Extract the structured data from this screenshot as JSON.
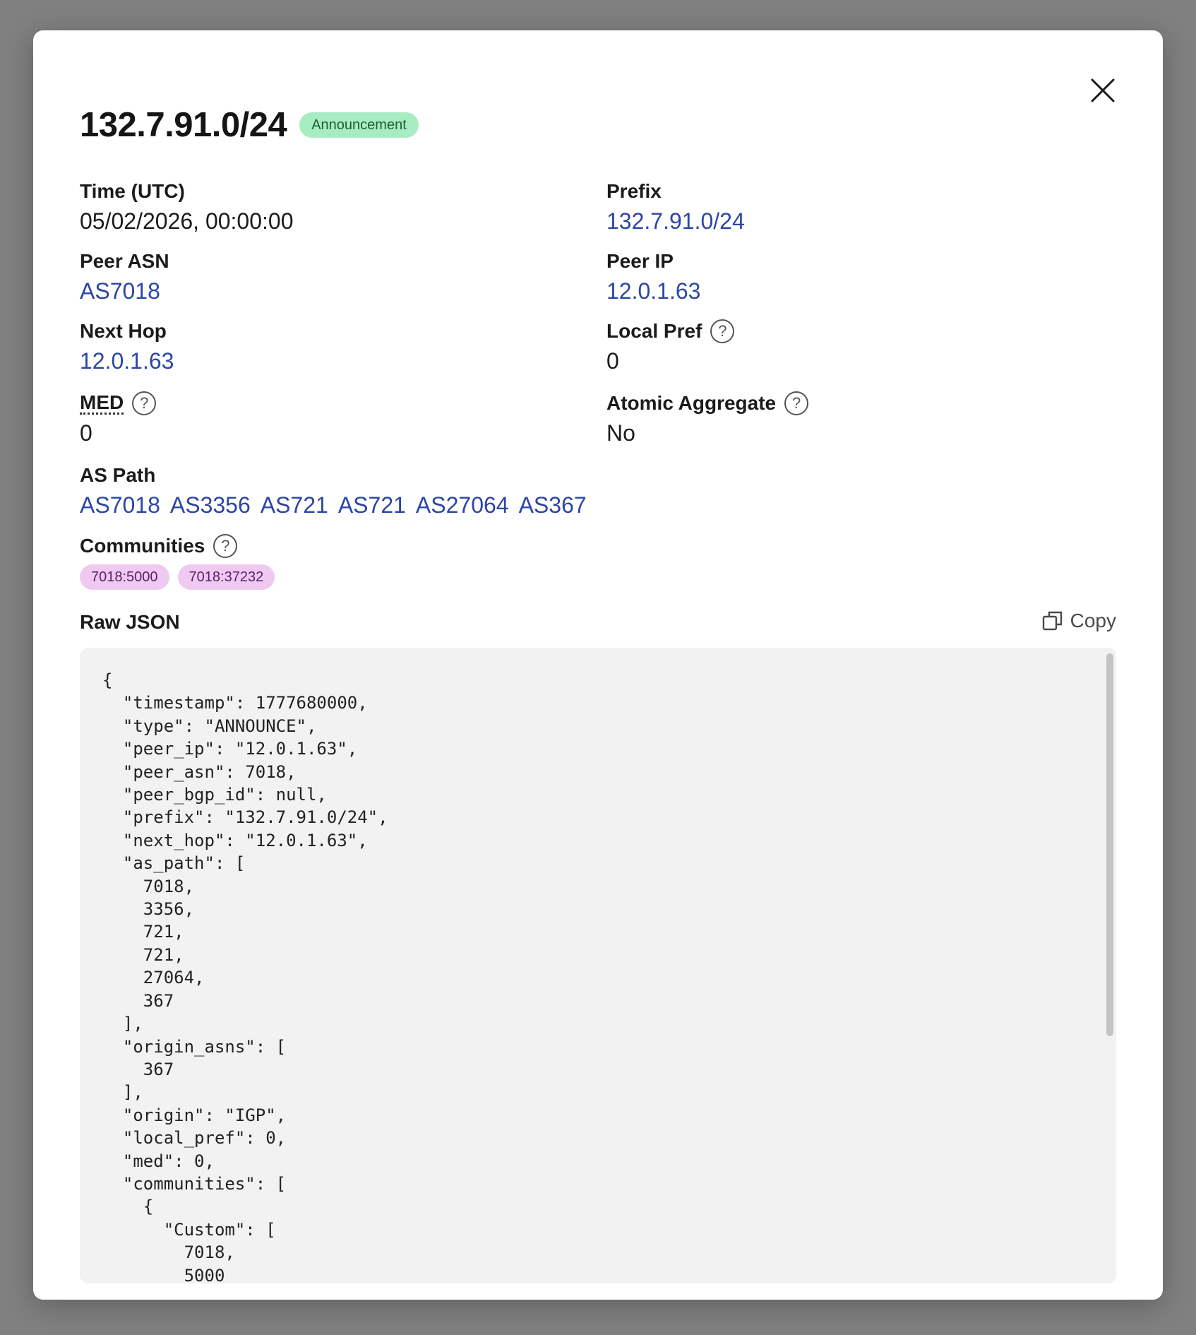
{
  "modal": {
    "title": "132.7.91.0/24",
    "badge": "Announcement",
    "close_icon": "close-icon"
  },
  "fields": {
    "time": {
      "label": "Time (UTC)",
      "value": "05/02/2026, 00:00:00"
    },
    "prefix": {
      "label": "Prefix",
      "value": "132.7.91.0/24"
    },
    "peer_asn": {
      "label": "Peer ASN",
      "value": "AS7018"
    },
    "peer_ip": {
      "label": "Peer IP",
      "value": "12.0.1.63"
    },
    "next_hop": {
      "label": "Next Hop",
      "value": "12.0.1.63"
    },
    "local_pref": {
      "label": "Local Pref",
      "value": "0"
    },
    "med": {
      "label": "MED",
      "value": "0"
    },
    "atomic_aggregate": {
      "label": "Atomic Aggregate",
      "value": "No"
    },
    "as_path": {
      "label": "AS Path",
      "items": [
        "AS7018",
        "AS3356",
        "AS721",
        "AS721",
        "AS27064",
        "AS367"
      ]
    },
    "communities": {
      "label": "Communities",
      "items": [
        "7018:5000",
        "7018:37232"
      ]
    }
  },
  "help_glyph": "?",
  "raw_json": {
    "title": "Raw JSON",
    "copy_label": "Copy",
    "copy_icon": "copy-icon",
    "text": "{\n  \"timestamp\": 1777680000,\n  \"type\": \"ANNOUNCE\",\n  \"peer_ip\": \"12.0.1.63\",\n  \"peer_asn\": 7018,\n  \"peer_bgp_id\": null,\n  \"prefix\": \"132.7.91.0/24\",\n  \"next_hop\": \"12.0.1.63\",\n  \"as_path\": [\n    7018,\n    3356,\n    721,\n    721,\n    27064,\n    367\n  ],\n  \"origin_asns\": [\n    367\n  ],\n  \"origin\": \"IGP\",\n  \"local_pref\": 0,\n  \"med\": 0,\n  \"communities\": [\n    {\n      \"Custom\": [\n        7018,\n        5000"
  },
  "colors": {
    "link": "#2c46a6",
    "badge_bg": "#a7ecc3",
    "chip_bg": "#efc9f2",
    "json_bg": "#f2f2f2"
  }
}
